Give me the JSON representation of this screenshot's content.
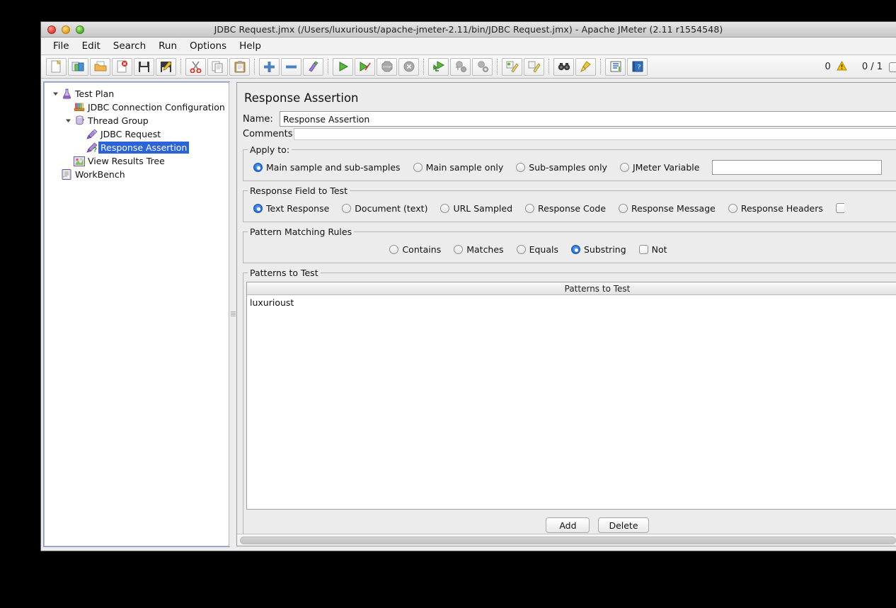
{
  "window": {
    "title": "JDBC Request.jmx (/Users/luxurioust/apache-jmeter-2.11/bin/JDBC Request.jmx) - Apache JMeter (2.11 r1554548)"
  },
  "menubar": {
    "items": [
      {
        "label": "File"
      },
      {
        "label": "Edit"
      },
      {
        "label": "Search"
      },
      {
        "label": "Run"
      },
      {
        "label": "Options"
      },
      {
        "label": "Help"
      }
    ]
  },
  "toolbar": {
    "buttons": [
      {
        "name": "new-icon"
      },
      {
        "name": "templates-icon"
      },
      {
        "name": "open-icon"
      },
      {
        "name": "close-icon"
      },
      {
        "name": "save-icon"
      },
      {
        "name": "save-as-icon"
      },
      {
        "name": "cut-icon"
      },
      {
        "name": "copy-icon"
      },
      {
        "name": "paste-icon"
      },
      {
        "name": "expand-icon"
      },
      {
        "name": "collapse-icon"
      },
      {
        "name": "toggle-icon"
      },
      {
        "name": "start-icon"
      },
      {
        "name": "start-no-timers-icon"
      },
      {
        "name": "stop-icon"
      },
      {
        "name": "shutdown-icon"
      },
      {
        "name": "remote-start-all-icon"
      },
      {
        "name": "remote-stop-all-icon"
      },
      {
        "name": "remote-shutdown-all-icon"
      },
      {
        "name": "clear-icon"
      },
      {
        "name": "clear-all-icon"
      },
      {
        "name": "search-icon"
      },
      {
        "name": "search-reset-icon"
      },
      {
        "name": "function-helper-icon"
      },
      {
        "name": "help-icon"
      }
    ],
    "warning_count": "0",
    "thread_counter": "0 / 1"
  },
  "tree": {
    "nodes": [
      {
        "label": "Test Plan",
        "icon": "test-plan-icon",
        "depth": 0,
        "twisty": "open",
        "selected": false
      },
      {
        "label": "JDBC Connection Configuration",
        "icon": "jdbc-config-icon",
        "depth": 1,
        "twisty": "none",
        "selected": false
      },
      {
        "label": "Thread Group",
        "icon": "thread-group-icon",
        "depth": 1,
        "twisty": "open",
        "selected": false
      },
      {
        "label": "JDBC Request",
        "icon": "jdbc-request-icon",
        "depth": 2,
        "twisty": "none",
        "selected": false
      },
      {
        "label": "Response Assertion",
        "icon": "response-assertion-icon",
        "depth": 2,
        "twisty": "none",
        "selected": true
      },
      {
        "label": "View Results Tree",
        "icon": "view-results-tree-icon",
        "depth": 1,
        "twisty": "none",
        "selected": false
      },
      {
        "label": "WorkBench",
        "icon": "workbench-icon",
        "depth": 0,
        "twisty": "none",
        "selected": false
      }
    ]
  },
  "editor": {
    "panel_title": "Response Assertion",
    "name_label": "Name:",
    "name_value": "Response Assertion",
    "comments_label": "Comments:",
    "comments_value": "",
    "apply_to": {
      "legend": "Apply to:",
      "options": [
        {
          "label": "Main sample and sub-samples",
          "selected": true
        },
        {
          "label": "Main sample only",
          "selected": false
        },
        {
          "label": "Sub-samples only",
          "selected": false
        },
        {
          "label": "JMeter Variable",
          "selected": false
        }
      ],
      "variable_value": ""
    },
    "response_field": {
      "legend": "Response Field to Test",
      "options": [
        {
          "label": "Text Response",
          "selected": true
        },
        {
          "label": "Document (text)",
          "selected": false
        },
        {
          "label": "URL Sampled",
          "selected": false
        },
        {
          "label": "Response Code",
          "selected": false
        },
        {
          "label": "Response Message",
          "selected": false
        },
        {
          "label": "Response Headers",
          "selected": false
        }
      ]
    },
    "pattern_rules": {
      "legend": "Pattern Matching Rules",
      "options": [
        {
          "label": "Contains",
          "selected": false
        },
        {
          "label": "Matches",
          "selected": false
        },
        {
          "label": "Equals",
          "selected": false
        },
        {
          "label": "Substring",
          "selected": true
        }
      ],
      "not_label": "Not",
      "not_checked": false
    },
    "patterns": {
      "legend": "Patterns to Test",
      "column_header": "Patterns to Test",
      "rows": [
        "luxurioust"
      ]
    },
    "buttons": {
      "add_label": "Add",
      "delete_label": "Delete"
    }
  },
  "colors": {
    "selection_blue": "#2b63d9",
    "radio_blue": "#2f76e0",
    "panel_bg": "#ececec",
    "warning_yellow": "#f2c200"
  }
}
